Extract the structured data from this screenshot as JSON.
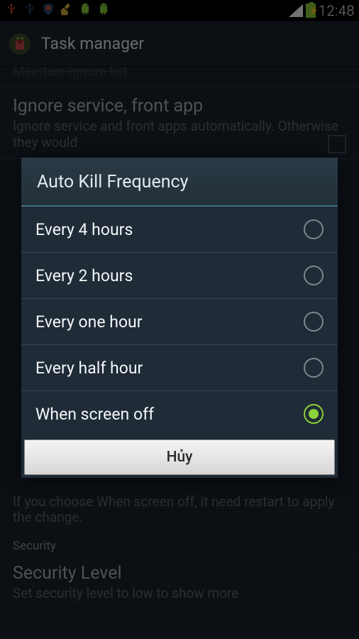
{
  "status": {
    "time": "12:48"
  },
  "app": {
    "title": "Task manager"
  },
  "bg": {
    "row0": "Maintain Ignore list",
    "row1_title": "Ignore service, front app",
    "row1_sub": "Ignore service and front apps automatically. Otherwise they would",
    "note": "If you choose When screen off, it need restart to apply the change.",
    "section": "Security",
    "sec_title": "Security Level",
    "sec_sub": "Set security level to low to show more"
  },
  "dialog": {
    "title": "Auto Kill Frequency",
    "options": [
      {
        "label": "Every 4 hours",
        "selected": false
      },
      {
        "label": "Every 2 hours",
        "selected": false
      },
      {
        "label": "Every one hour",
        "selected": false
      },
      {
        "label": "Every half hour",
        "selected": false
      },
      {
        "label": "When screen off",
        "selected": true
      }
    ],
    "cancel": "Hủy"
  }
}
